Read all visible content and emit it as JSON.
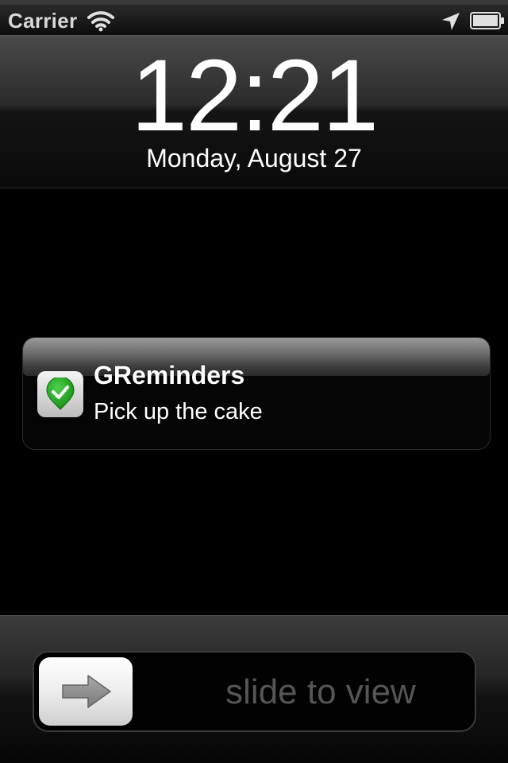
{
  "status_bar": {
    "carrier": "Carrier",
    "wifi_icon": "wifi-icon",
    "location_icon": "location-arrow-icon",
    "battery_icon": "battery-full-icon"
  },
  "lock_screen": {
    "time": "12:21",
    "date": "Monday, August 27"
  },
  "notification": {
    "app_icon": "green-check-shield-icon",
    "app_name": "GReminders",
    "message": "Pick up the cake"
  },
  "slider": {
    "label": "slide to view",
    "knob_icon": "right-arrow-icon"
  },
  "colors": {
    "background": "#000000",
    "text": "#ffffff",
    "slider_label": "#555555",
    "check_green": "#2aa32a"
  }
}
